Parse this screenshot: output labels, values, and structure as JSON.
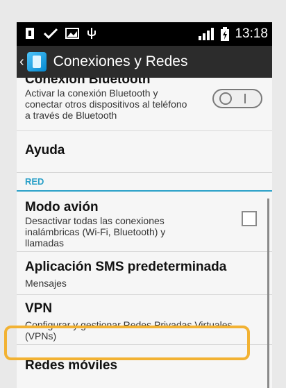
{
  "status": {
    "time": "13:18"
  },
  "header": {
    "title": "Conexiones y Redes"
  },
  "items": [
    {
      "title": "Conexión Bluetooth",
      "subtitle": "Activar la conexión Bluetooth y conectar otros dispositivos al teléfono a través de Bluetooth"
    },
    {
      "title": "Ayuda",
      "subtitle": ""
    },
    {
      "section": "RED"
    },
    {
      "title": "Modo avión",
      "subtitle": "Desactivar todas las conexiones inalámbricas (Wi-Fi, Bluetooth) y llamadas"
    },
    {
      "title": "Aplicación SMS predeterminada",
      "subtitle": "Mensajes"
    },
    {
      "title": "VPN",
      "subtitle": "Configurar y gestionar Redes Privadas Virtuales (VPNs)"
    },
    {
      "title": "Redes móviles",
      "subtitle": ""
    }
  ],
  "toggles": {
    "bluetooth_state": "off"
  },
  "checkboxes": {
    "airplane_mode": false
  },
  "colors": {
    "accent": "#2aa0c8",
    "highlight": "#f2b233"
  },
  "icons": [
    "usb-debug-icon",
    "check-icon",
    "image-icon",
    "usb-icon",
    "signal-icon",
    "battery-icon",
    "back-chevron-icon",
    "connections-app-icon"
  ]
}
